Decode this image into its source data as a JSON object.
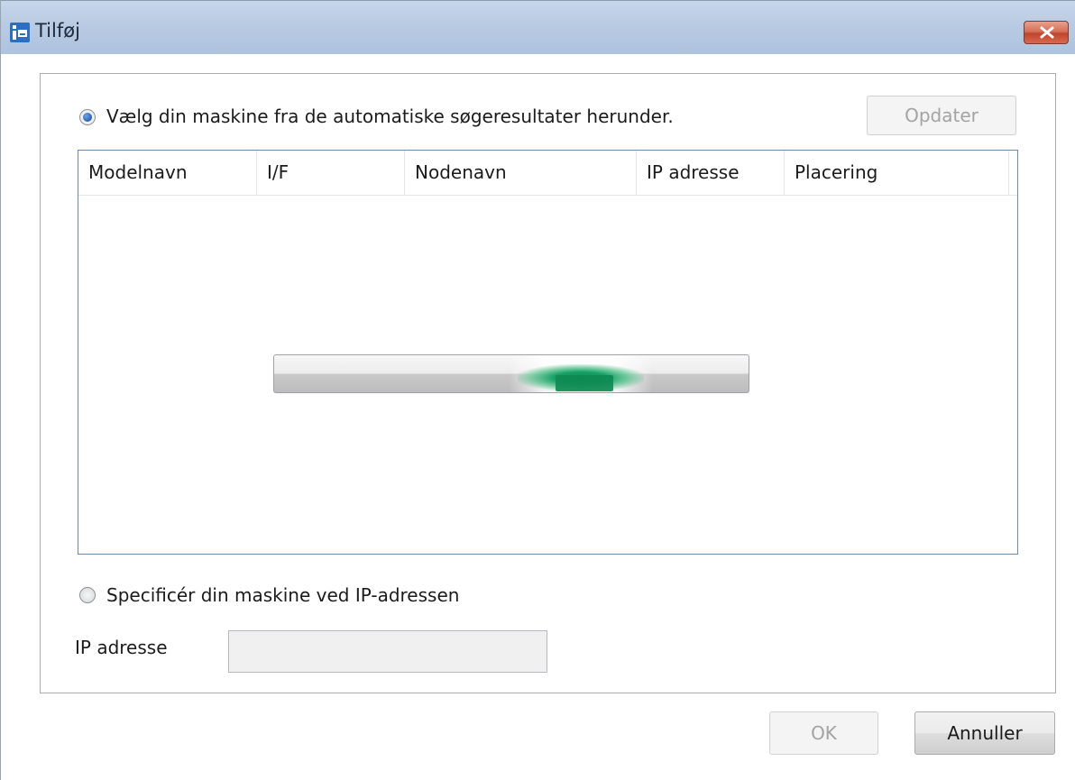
{
  "window": {
    "title": "Tilføj"
  },
  "search_option": {
    "label": "Vælg din maskine fra de automatiske søgeresultater herunder.",
    "selected": true,
    "update_button_label": "Opdater"
  },
  "results_table": {
    "columns": [
      "Modelnavn",
      "I/F",
      "Nodenavn",
      "IP adresse",
      "Placering"
    ],
    "rows": []
  },
  "progress": {
    "state": "indeterminate",
    "color": "#0d8a52"
  },
  "ip_option": {
    "label": "Specificér din maskine ved IP-adressen",
    "selected": false,
    "field_label": "IP adresse",
    "field_value": ""
  },
  "footer": {
    "ok_label": "OK",
    "cancel_label": "Annuller"
  },
  "icons": {
    "app": "printer-add-icon",
    "close": "close-icon"
  }
}
